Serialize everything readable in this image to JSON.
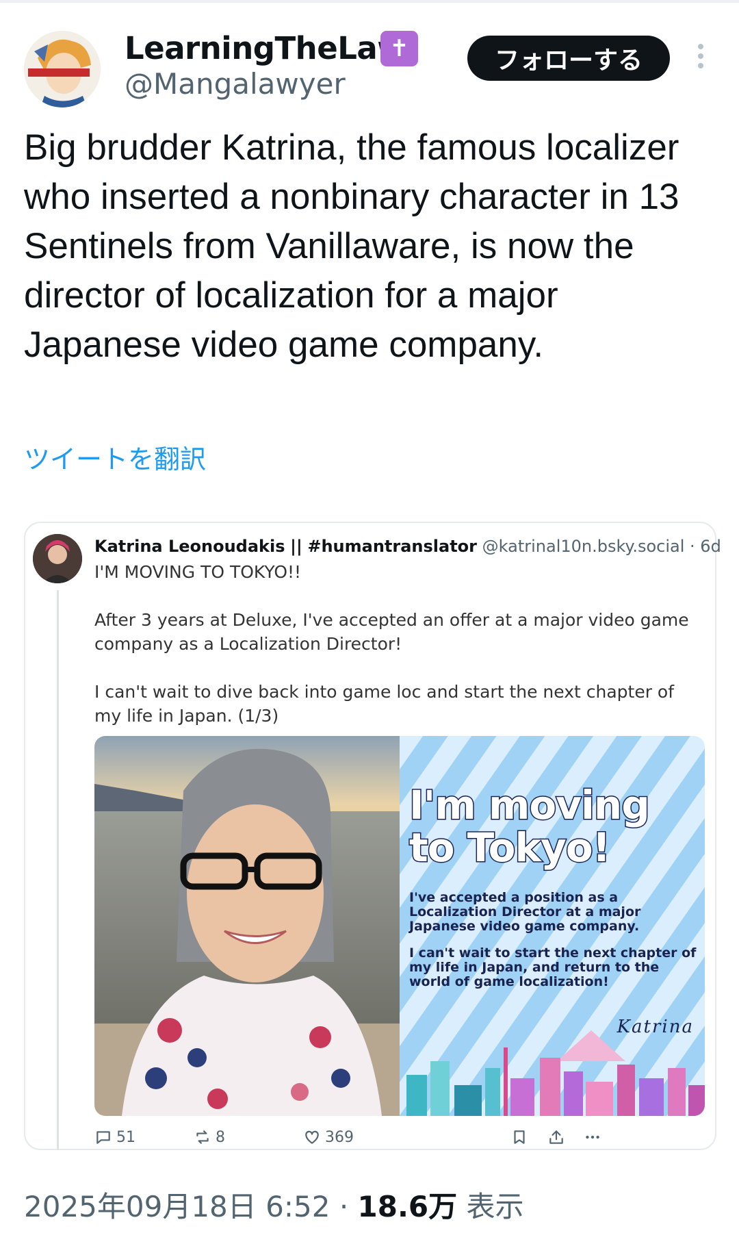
{
  "author": {
    "display_name": "LearningTheLaw",
    "badge": "✝",
    "handle": "@Mangalawyer"
  },
  "follow_label": "フォローする",
  "tweet_text": "Big brudder Katrina, the famous localizer who inserted a nonbinary character in 13 Sentinels from Vanillaware, is now the director of localization for a major Japanese video game company.",
  "translate_label": "ツイートを翻訳",
  "quote": {
    "name": "Katrina Leonoudakis",
    "tag": "#humantranslator",
    "separator": "||",
    "handle": "@katrinal10n.bsky.social",
    "dot": "·",
    "time": "6d",
    "text": "I'M MOVING TO TOKYO!!\n\nAfter 3 years at Deluxe, I've accepted an offer at a major video game company as a Localization Director!\n\nI can't wait to dive back into game loc and start the next chapter of my life in Japan. (1/3)",
    "graphic": {
      "title": "I'm moving to Tokyo!",
      "paragraph_1": "I've accepted a position as a Localization Director at a major Japanese video game company.",
      "paragraph_2": "I can't wait to start the next chapter of my life in Japan, and return to the world of game localization!",
      "signature": "Katrina"
    },
    "actions": {
      "replies": "51",
      "reposts": "8",
      "likes": "369"
    }
  },
  "footer": {
    "datetime": "2025年09月18日 6:52",
    "dot": "·",
    "views": "18.6万",
    "views_label": "表示"
  },
  "colors": {
    "accent": "#1d9bf0",
    "follow_bg": "#0f1419",
    "badge": "#b06ad8",
    "muted": "#536471"
  },
  "icons": [
    "more-vertical-icon",
    "reply-icon",
    "repost-icon",
    "like-icon",
    "bookmark-icon",
    "share-icon",
    "more-horizontal-icon"
  ]
}
